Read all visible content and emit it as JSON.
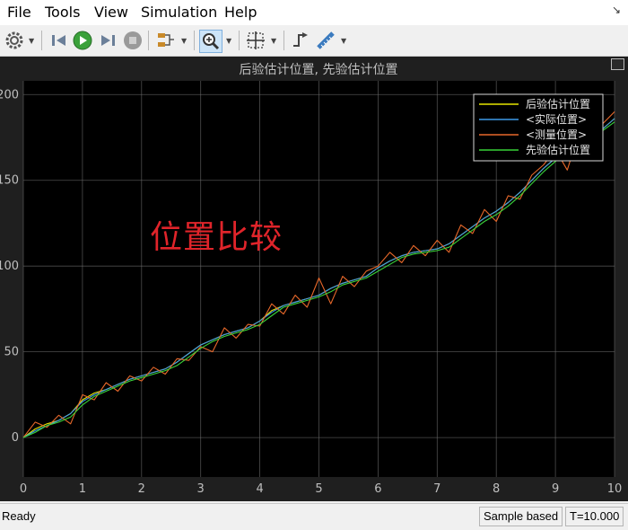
{
  "menu": {
    "items": [
      "File",
      "Tools",
      "View",
      "Simulation",
      "Help"
    ],
    "overflow_icon": "arrow-icon"
  },
  "toolbar": {
    "icons": [
      "gear-icon",
      "step-back-icon",
      "run-icon",
      "step-forward-icon",
      "stop-icon",
      "signal-selector-icon",
      "zoom-in-icon",
      "fit-to-view-icon",
      "triggers-icon",
      "cursor-measurements-icon"
    ]
  },
  "overlay_text": "位置比较",
  "status": {
    "ready": "Ready",
    "sample_mode": "Sample based",
    "time": "T=10.000"
  },
  "colors": {
    "background": "#000000",
    "figure": "#1f1f1f",
    "axis_text": "#bfbfbf",
    "grid": "#6e6e6e",
    "overlay_text": "#e0242a"
  },
  "chart_data": {
    "type": "line",
    "title": "后验估计位置, 先验估计位置",
    "xlim": [
      0,
      10
    ],
    "ylim": [
      -23,
      208
    ],
    "xticks": [
      0,
      1,
      2,
      3,
      4,
      5,
      6,
      7,
      8,
      9,
      10
    ],
    "yticks": [
      0,
      50,
      100,
      150,
      200
    ],
    "grid": true,
    "legend_position": "top-right",
    "x": [
      0,
      0.2,
      0.4,
      0.6,
      0.8,
      1.0,
      1.2,
      1.4,
      1.6,
      1.8,
      2.0,
      2.2,
      2.4,
      2.6,
      2.8,
      3.0,
      3.2,
      3.4,
      3.6,
      3.8,
      4.0,
      4.2,
      4.4,
      4.6,
      4.8,
      5.0,
      5.2,
      5.4,
      5.6,
      5.8,
      6.0,
      6.2,
      6.4,
      6.6,
      6.8,
      7.0,
      7.2,
      7.4,
      7.6,
      7.8,
      8.0,
      8.2,
      8.4,
      8.6,
      8.8,
      9.0,
      9.2,
      9.4,
      9.6,
      9.8,
      10.0
    ],
    "series": [
      {
        "name": "后验估计位置",
        "color": "#e5e500",
        "values": [
          0,
          5,
          8,
          10,
          14,
          22,
          26,
          28,
          31,
          34,
          36,
          38,
          40,
          44,
          49,
          54,
          57,
          60,
          62,
          64,
          68,
          74,
          77,
          79,
          81,
          83,
          87,
          90,
          92,
          94,
          99,
          103,
          106,
          108,
          109,
          110,
          113,
          118,
          123,
          128,
          132,
          137,
          143,
          150,
          157,
          163,
          168,
          172,
          176,
          180,
          186
        ]
      },
      {
        "name": "<实际位置>",
        "color": "#3d9be9",
        "values": [
          0,
          4,
          7,
          10,
          14,
          21,
          25,
          28,
          31,
          34,
          36,
          38,
          40,
          44,
          49,
          54,
          57,
          60,
          62,
          64,
          68,
          73,
          77,
          79,
          81,
          83,
          87,
          90,
          92,
          94,
          99,
          103,
          106,
          108,
          109,
          110,
          113,
          118,
          123,
          128,
          132,
          137,
          143,
          150,
          157,
          163,
          168,
          172,
          176,
          180,
          186
        ]
      },
      {
        "name": "<测量位置>",
        "color": "#e8682a",
        "values": [
          0,
          9,
          6,
          13,
          8,
          25,
          22,
          32,
          27,
          36,
          33,
          41,
          37,
          46,
          45,
          53,
          50,
          64,
          58,
          66,
          65,
          78,
          72,
          83,
          76,
          93,
          78,
          94,
          88,
          97,
          100,
          108,
          102,
          112,
          106,
          115,
          108,
          124,
          119,
          133,
          126,
          141,
          139,
          153,
          159,
          168,
          156,
          178,
          170,
          183,
          190
        ]
      },
      {
        "name": "先验估计位置",
        "color": "#39d339",
        "values": [
          0,
          3,
          7,
          9,
          12,
          19,
          24,
          27,
          30,
          33,
          35,
          37,
          39,
          42,
          47,
          52,
          56,
          59,
          61,
          63,
          66,
          71,
          76,
          78,
          80,
          82,
          85,
          89,
          91,
          93,
          97,
          101,
          105,
          107,
          108,
          109,
          111,
          116,
          121,
          126,
          130,
          135,
          141,
          148,
          155,
          161,
          166,
          171,
          175,
          179,
          184
        ]
      }
    ]
  }
}
